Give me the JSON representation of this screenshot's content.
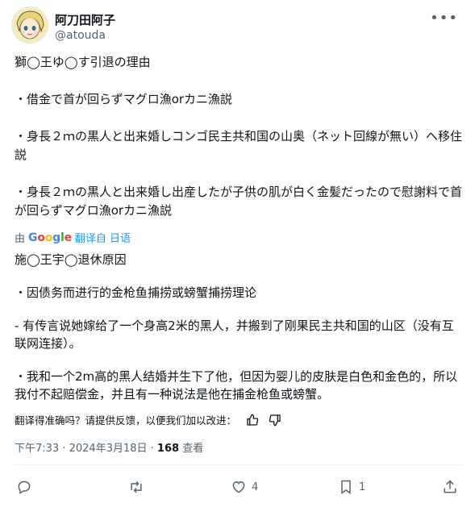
{
  "user": {
    "display_name": "阿刀田阿子",
    "handle": "@atouda",
    "avatar_icon": "anime-avatar"
  },
  "more_icon": "more-icon",
  "original_text": [
    "獅◯王ゆ◯す引退の理由",
    "・借金で首が回らずマグロ漁orカニ漁説",
    "・身長２ｍの黒人と出来婚しコンゴ民主共和国の山奥（ネット回線が無い）へ移住説",
    "・身長２ｍの黒人と出来婚し出産したが子供の肌が白く金髪だったので慰謝料で首が回らずマグロ漁orカニ漁説"
  ],
  "translation_bar": {
    "prefix": "由",
    "google": [
      "G",
      "o",
      "o",
      "g",
      "l",
      "e"
    ],
    "link": "翻译自 日语"
  },
  "translated_text": [
    "施◯王宇◯退休原因",
    "・因债务而进行的金枪鱼捕捞或螃蟹捕捞理论",
    "- 有传言说她嫁给了一个身高2米的黑人，并搬到了刚果民主共和国的山区（没有互联网连接）。",
    "・我和一个2m高的黑人结婚并生下了他，但因为婴儿的皮肤是白色和金色的，所以我付不起赔偿金，并且有一种说法是他在捕金枪鱼或螃蟹。"
  ],
  "feedback": {
    "text": "翻译得准确吗？请提供反馈，以便我们加以改进：",
    "thumbs_up_icon": "thumbs-up-icon",
    "thumbs_down_icon": "thumbs-down-icon"
  },
  "meta": {
    "time": "下午7:33",
    "separator": " · ",
    "date": "2024年3月18日",
    "views": "168",
    "views_label": " 查看"
  },
  "actions": {
    "reply_count": "",
    "retweet_count": "",
    "like_count": "4",
    "bookmark_count": "1"
  }
}
